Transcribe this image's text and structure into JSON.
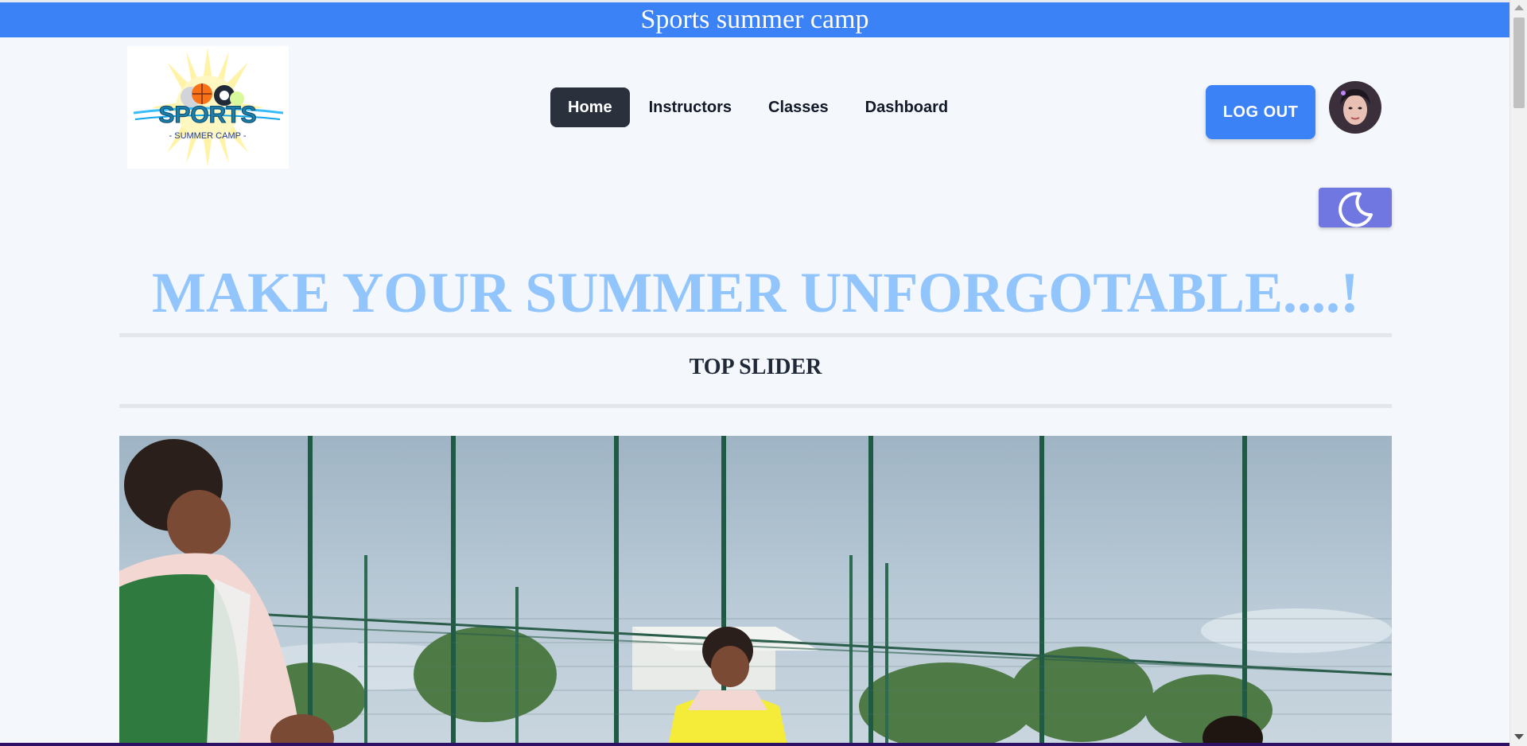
{
  "banner": {
    "title": "Sports summer camp",
    "color": "#3b82f6"
  },
  "logo": {
    "main_text": "SPORTS",
    "sub_text": "- SUMMER CAMP -"
  },
  "nav": {
    "items": [
      {
        "label": "Home",
        "active": true
      },
      {
        "label": "Instructors",
        "active": false
      },
      {
        "label": "Classes",
        "active": false
      },
      {
        "label": "Dashboard",
        "active": false
      }
    ]
  },
  "header": {
    "logout_label": "LOG OUT",
    "avatar_icon": "user-avatar",
    "theme_toggle_icon": "moon-icon"
  },
  "hero": {
    "title": "MAKE YOUR SUMMER UNFORGOTABLE....!",
    "title_color": "#93c5fd"
  },
  "slider": {
    "section_title": "TOP SLIDER",
    "image_icon": "slider-photo"
  },
  "colors": {
    "accent": "#3b82f6",
    "nav_active": "#2a303c",
    "toggle": "#7077e0",
    "background": "#f4f7fb"
  }
}
